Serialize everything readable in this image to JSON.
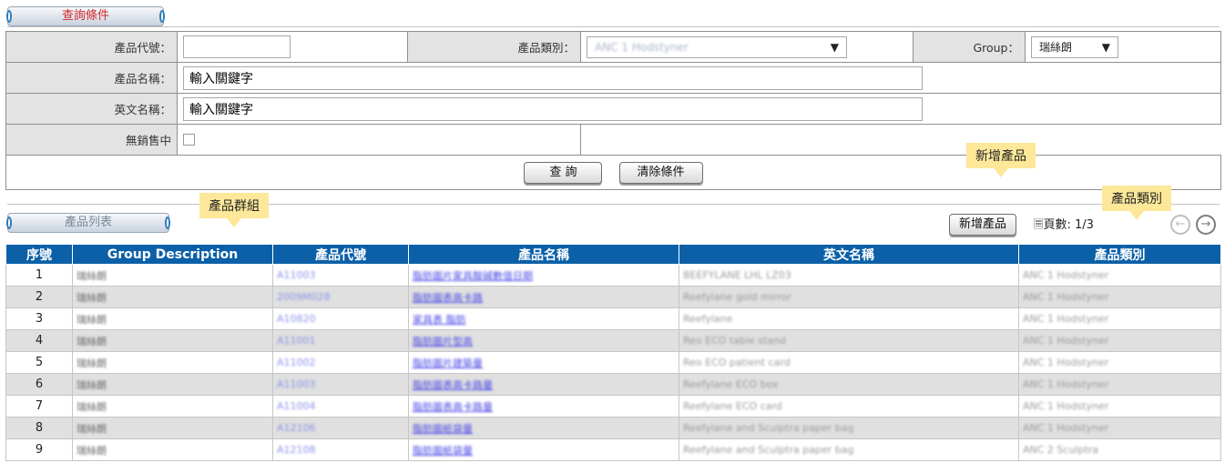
{
  "query_section": {
    "tab_label": "查詢條件",
    "product_code_label": "產品代號：",
    "product_code_value": "",
    "product_category_label": "產品類別：",
    "product_category_value": "ANC 1 Hodstyner",
    "group_label": "Group：",
    "group_value": "瑞絲朗",
    "product_name_label": "產品名稱：",
    "product_name_value": "輸入關鍵字",
    "english_name_label": "英文名稱：",
    "english_name_value": "輸入關鍵字",
    "no_sales_label": "無銷售中",
    "search_button": "查 詢",
    "clear_button": "清除條件"
  },
  "list_section": {
    "tab_label": "產品列表",
    "add_product_button": "新增產品",
    "page_count": "頁數: 1/3"
  },
  "callouts": {
    "add_product": "新增產品",
    "product_group": "產品群組",
    "product_category": "產品類別"
  },
  "table": {
    "headers": [
      "序號",
      "Group Description",
      "產品代號",
      "產品名稱",
      "英文名稱",
      "產品類別"
    ],
    "rows": [
      [
        "1",
        "瑞絲朗",
        "A11003",
        "脂肪圖片家具酸碱數值日期",
        "BEEFYLANE LHL LZ03",
        "ANC 1 Hodstyner"
      ],
      [
        "2",
        "瑞絲朗",
        "2009M028",
        "脂肪圖表高卡路",
        "Reefylane gold mirror",
        "ANC 1 Hodstyner"
      ],
      [
        "3",
        "瑞絲朗",
        "A10820",
        "家具表 脂肪",
        "Reefylane",
        "ANC 1 Hodstyner"
      ],
      [
        "4",
        "瑞絲朗",
        "A11001",
        "脂肪圖片型高",
        "Reo ECO table stand",
        "ANC 1 Hodstyner"
      ],
      [
        "5",
        "瑞絲朗",
        "A11002",
        "脂肪圖片建築量",
        "Reo ECO patient card",
        "ANC 1 Hodstyner"
      ],
      [
        "6",
        "瑞絲朗",
        "A11003",
        "脂肪圖表高卡路量",
        "Reefylane ECO box",
        "ANC 1 Hodstyner"
      ],
      [
        "7",
        "瑞絲朗",
        "A11004",
        "脂肪圖表高卡路量",
        "Reefylane ECO card",
        "ANC 1 Hodstyner"
      ],
      [
        "8",
        "瑞絲朗",
        "A12106",
        "脂肪圖紙袋量",
        "Reefylane and Sculptra paper bag",
        "ANC 1 Hodstyner"
      ],
      [
        "9",
        "瑞絲朗",
        "A12108",
        "脂肪圖紙袋量",
        "Reefylane and Sculptra paper bag",
        "ANC 2 Sculptra"
      ]
    ]
  }
}
